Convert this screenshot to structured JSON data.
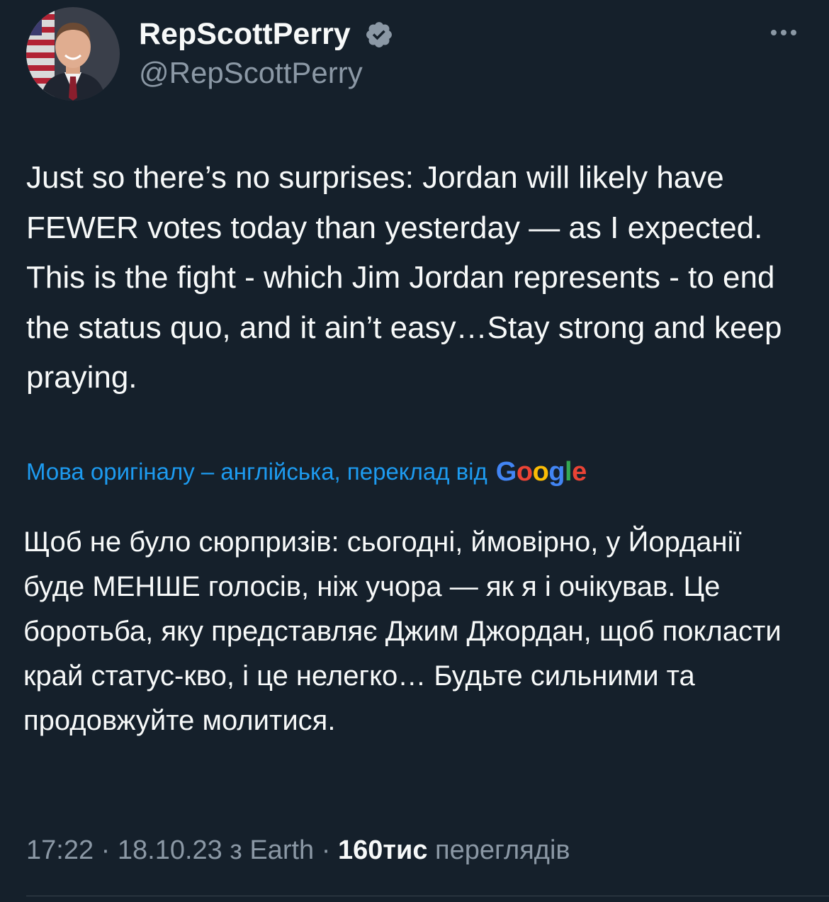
{
  "author": {
    "display_name": "RepScottPerry",
    "handle": "@RepScottPerry",
    "verified_icon": "verified-badge-icon",
    "avatar_icon": "profile-avatar"
  },
  "more_icon": "more-options-icon",
  "tweet": {
    "text": "Just so there’s no surprises: Jordan will likely have FEWER votes today than yesterday — as I expected. This is the fight - which Jim Jordan represents - to end the status quo, and it ain’t easy…Stay strong and keep praying."
  },
  "translation": {
    "label": "Мова оригіналу – англійська, переклад від",
    "provider_logo": {
      "letters": [
        "G",
        "o",
        "o",
        "g",
        "l",
        "e"
      ],
      "colors": [
        "#4285f4",
        "#ea4335",
        "#fbbc05",
        "#4285f4",
        "#34a853",
        "#ea4335"
      ]
    },
    "text": "Щоб не було сюрпризів: сьогодні, ймовірно, у Йорданії буде МЕНШЕ голосів, ніж учора — як я і очікував. Це боротьба, яку представляє Джим Джордан, щоб покласти край статус-кво, і це нелегко… Будьте сильними та продовжуйте молитися."
  },
  "meta": {
    "time": "17:22",
    "separator": " · ",
    "date": "18.10.23",
    "source": "з Earth",
    "views_count": "160тис",
    "views_label": "переглядів"
  },
  "colors": {
    "background": "#15202b",
    "text_primary": "#f7f9f9",
    "text_secondary": "#8b98a5",
    "link": "#1d9bf0",
    "divider": "#38444d"
  }
}
